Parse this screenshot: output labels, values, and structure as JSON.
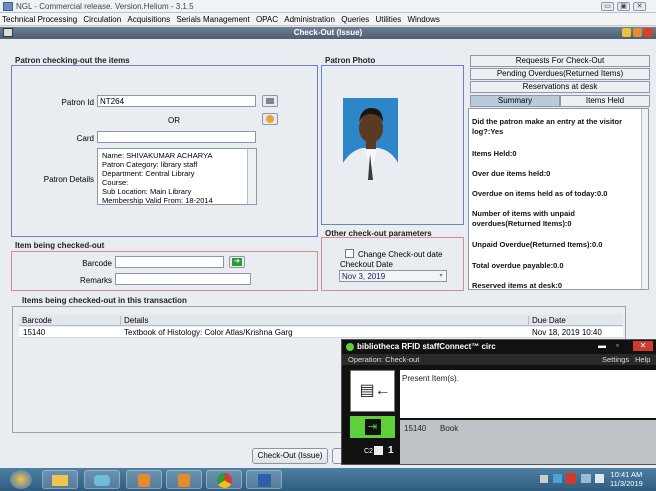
{
  "window": {
    "title": "NGL - Commercial release. Version.Helium - 3.1.5"
  },
  "menu": [
    "Technical Processing",
    "Circulation",
    "Acquisitions",
    "Serials Management",
    "OPAC",
    "Administration",
    "Queries",
    "Utilities",
    "Windows"
  ],
  "frame": {
    "title": "Check-Out (Issue)"
  },
  "patron_section": {
    "label": "Patron checking-out the items",
    "patron_id_label": "Patron Id",
    "patron_id_value": "NT264",
    "or_label": "OR",
    "card_label": "Card",
    "card_value": "",
    "details_label": "Patron Details",
    "details_lines": [
      "Name: SHIVAKUMAR  ACHARYA",
      "Patron Category: library staff",
      "Department: Central Library",
      "Course:",
      "Sub Location: Main Library",
      "Membership Valid From: 18-2014"
    ]
  },
  "photo_section": {
    "label": "Patron Photo"
  },
  "other_params": {
    "label": "Other check-out parameters",
    "change_date_label": "Change Check-out date",
    "checkout_date_label": "Checkout Date",
    "checkout_date_value": "Nov 3, 2019"
  },
  "right_tabs": {
    "requests": "Requests For Check-Out",
    "pending": "Pending Overdues(Returned Items)",
    "reservations": "Reservations at desk",
    "summary": "Summary",
    "items_held": "Items Held"
  },
  "summary": [
    "Did the patron make an entry at the visitor log?:Yes",
    "Items Held:0",
    "Over due items held:0",
    "Overdue on items held as of today:0.0",
    "Number of items with unpaid overdues(Returned Items):0",
    "Unpaid Overdue(Returned Items):0.0",
    "Total overdue payable:0.0",
    "Reserved items at desk:0"
  ],
  "item_section": {
    "label": "Item being checked-out",
    "barcode_label": "Barcode",
    "barcode_value": "",
    "remarks_label": "Remarks",
    "remarks_value": ""
  },
  "transaction": {
    "label": "Items being checked-out in this transaction",
    "columns": [
      "Barcode",
      "Details",
      "Due Date"
    ],
    "rows": [
      {
        "barcode": "15140",
        "details": "Textbook of Histology: Color Atlas/Krishna Garg",
        "due": "Nov 18, 2019 10:40"
      }
    ]
  },
  "buttons": {
    "checkout": "Check-Out (Issue)"
  },
  "rfid": {
    "title": "bibliotheca RFID staffConnect™ circ",
    "operation": "Operation: Check-out",
    "settings": "Settings",
    "help": "Help",
    "prompt": "Present Item(s).",
    "item_barcode": "15140",
    "item_type": "Book",
    "count_label": "C2",
    "count": "1"
  },
  "taskbar": {
    "time": "10:41 AM",
    "date": "11/3/2019"
  },
  "colors": {
    "accent": "#4d5e71",
    "border_blue": "#6e7fc9",
    "border_red": "#d98a8a",
    "green": "#5fd03a"
  }
}
